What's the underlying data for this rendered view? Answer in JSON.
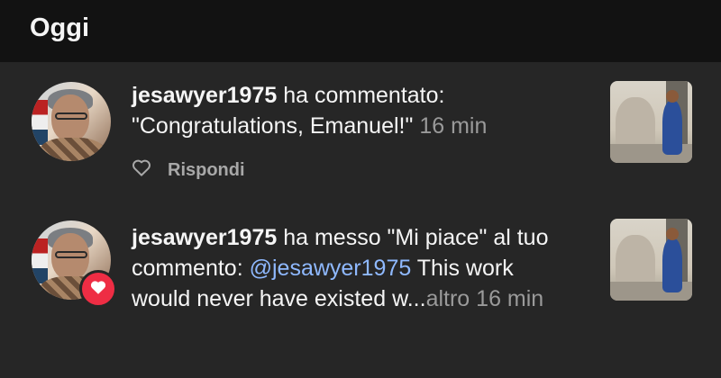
{
  "header": {
    "title": "Oggi"
  },
  "notifications": [
    {
      "username": "jesawyer1975",
      "action": " ha commentato:",
      "comment": "\"Congratulations, Emanuel!\"",
      "time": "16 min",
      "reply_label": "Rispondi"
    },
    {
      "username": "jesawyer1975",
      "action": " ha messo \"Mi piace\" al tuo commento: ",
      "mention": "@jesawyer1975",
      "text": " This work would never have existed w...",
      "more": "altro",
      "time": "16 min"
    }
  ],
  "colors": {
    "accent_like": "#ee2d44",
    "mention": "#8fb9ff",
    "muted": "#9a9a9a"
  }
}
